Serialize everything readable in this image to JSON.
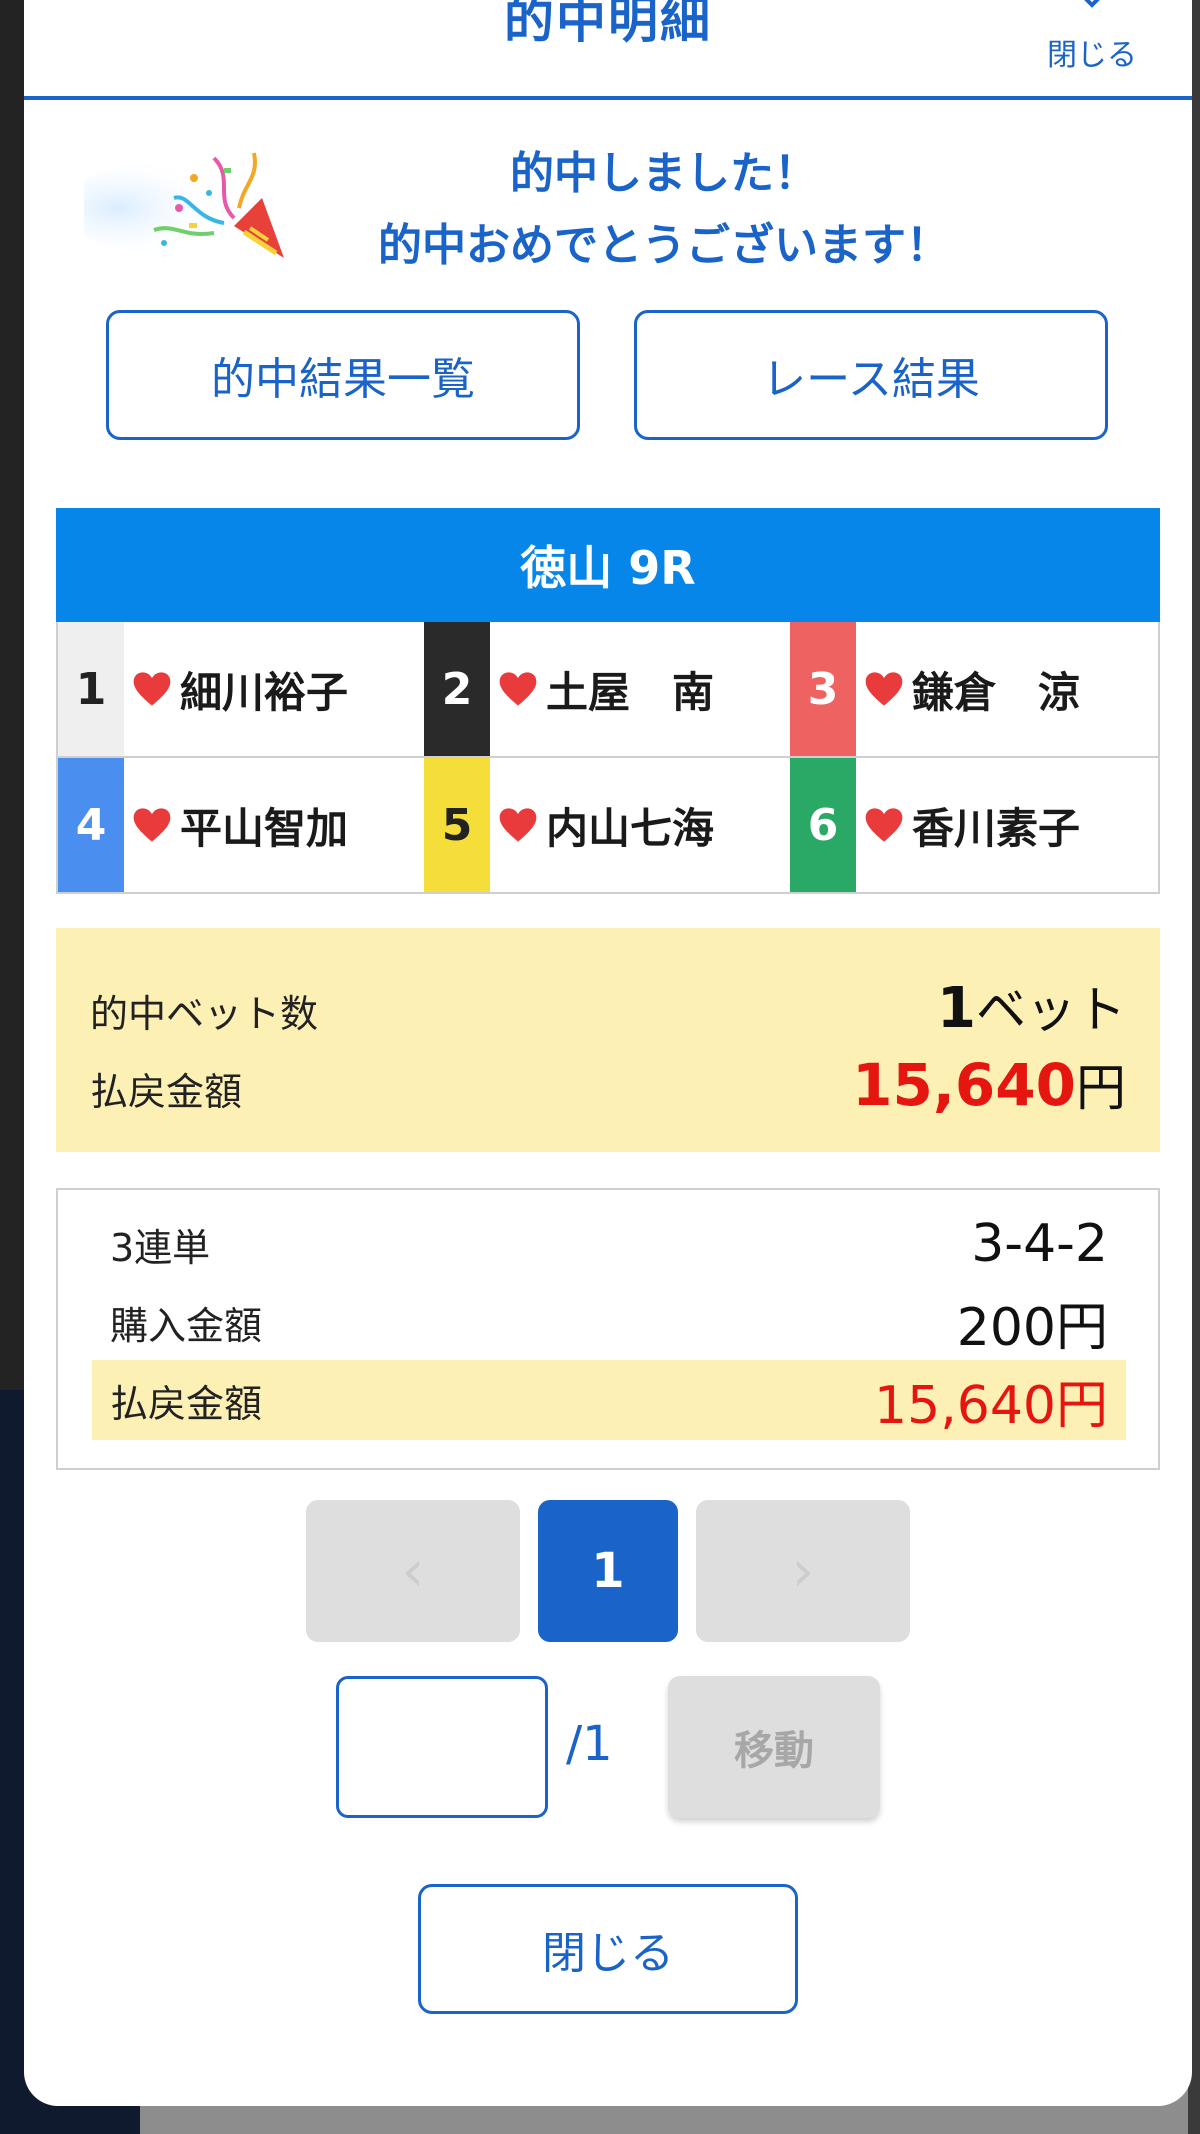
{
  "header": {
    "title": "的中明細",
    "close_label": "閉じる"
  },
  "congrats": {
    "line1": "的中しました！",
    "line2": "的中おめでとうございます！"
  },
  "buttons": {
    "results_list": "的中結果一覧",
    "race_results": "レース結果",
    "close": "閉じる"
  },
  "race": {
    "title": "徳山 9R",
    "racers": [
      {
        "number": "1",
        "name": "細川裕子",
        "color": "#efefef",
        "text_color": "#222222"
      },
      {
        "number": "2",
        "name": "土屋　南",
        "color": "#2a2a2a",
        "text_color": "#ffffff"
      },
      {
        "number": "3",
        "name": "鎌倉　涼",
        "color": "#ee6262",
        "text_color": "#ffffff"
      },
      {
        "number": "4",
        "name": "平山智加",
        "color": "#4a8ef0",
        "text_color": "#ffffff"
      },
      {
        "number": "5",
        "name": "内山七海",
        "color": "#f6de3a",
        "text_color": "#222222"
      },
      {
        "number": "6",
        "name": "香川素子",
        "color": "#2aa865",
        "text_color": "#ffffff"
      }
    ],
    "heart_color": "#e93b3b"
  },
  "summary": {
    "bets_label": "的中ベット数",
    "bets_value": "1",
    "bets_unit": "ベット",
    "payout_label": "払戻金額",
    "payout_value": "15,640",
    "payout_unit": "円"
  },
  "detail": {
    "bet_type": "3連単",
    "combination": "3-4-2",
    "purchase_label": "購入金額",
    "purchase_value": "200円",
    "payout_label": "払戻金額",
    "payout_value": "15,640円"
  },
  "pagination": {
    "prev": "‹",
    "current": "1",
    "next": "›",
    "input_value": "",
    "total": "/1",
    "jump_label": "移動"
  }
}
